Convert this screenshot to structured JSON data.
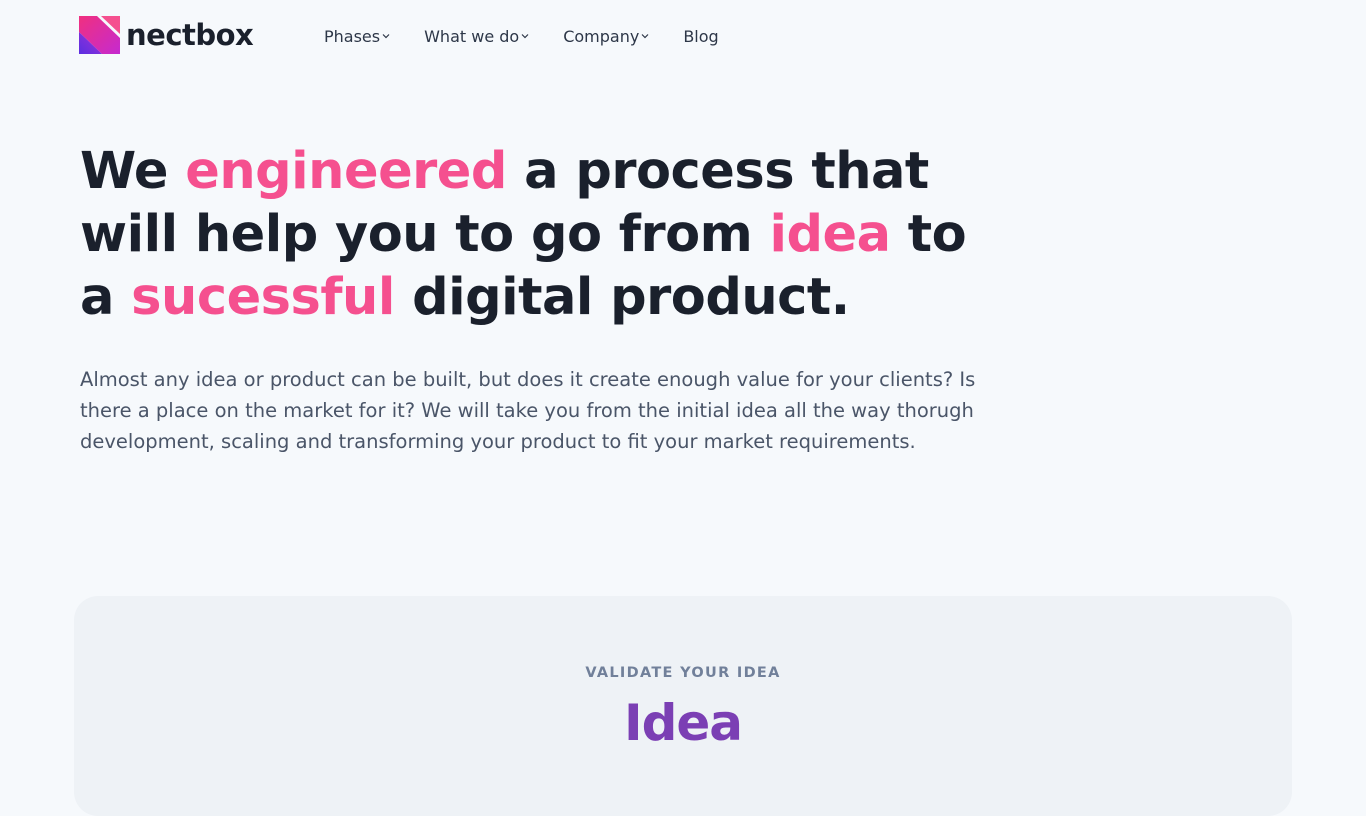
{
  "brand": {
    "name": "nectbox",
    "colors": {
      "primary": "#e5348f",
      "secondary": "#6b2fd6",
      "accent_pink": "#f5508f",
      "accent_purple": "#7b3fb4"
    }
  },
  "nav": {
    "items": [
      {
        "label": "Phases",
        "has_dropdown": true
      },
      {
        "label": "What we do",
        "has_dropdown": true
      },
      {
        "label": "Company",
        "has_dropdown": true
      },
      {
        "label": "Blog",
        "has_dropdown": false
      }
    ]
  },
  "hero": {
    "title": {
      "p1": "We ",
      "h1": "engineered",
      "p2": " a process that",
      "p3": "will help you to go from ",
      "h2": "idea",
      "p4": " to",
      "p5": "a ",
      "h3": "sucessful",
      "p6": " digital product."
    },
    "description": "Almost any idea or product can be built, but does it create enough value for your clients? Is there a place on the market for it? We will take you from the initial idea all the way thorugh development, scaling and transforming your product to fit your market requirements."
  },
  "phase_card": {
    "eyebrow": "VALIDATE YOUR IDEA",
    "title": "Idea"
  }
}
